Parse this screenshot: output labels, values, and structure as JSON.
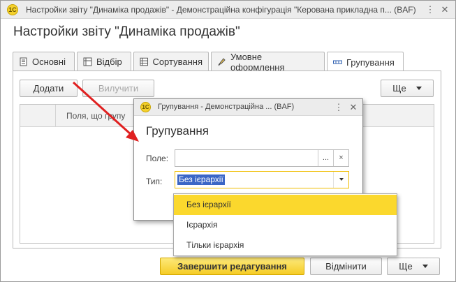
{
  "window": {
    "title": "Настройки звіту \"Динаміка продажів\" - Демонстраційна конфігурація \"Керована прикладна п... (BAF)",
    "logo": "1C"
  },
  "form_title": "Настройки звіту \"Динаміка продажів\"",
  "tabs": [
    {
      "label": "Основні",
      "icon": "document-icon"
    },
    {
      "label": "Відбір",
      "icon": "filter-icon"
    },
    {
      "label": "Сортування",
      "icon": "sort-icon"
    },
    {
      "label": "Умовне оформлення",
      "icon": "paint-icon"
    },
    {
      "label": "Групування",
      "icon": "grouping-icon"
    }
  ],
  "toolbar": {
    "add_label": "Додати",
    "exclude_label": "Вилучити",
    "more_label": "Ще"
  },
  "table": {
    "column_header": "Поля, що групу"
  },
  "dialog": {
    "title": "Групування - Демонстраційна ... (BAF)",
    "logo": "1C",
    "heading": "Групування",
    "field_label": "Поле:",
    "field_value": "",
    "type_label": "Тип:",
    "type_value": "Без ієрархії",
    "select_btn": "...",
    "clear_btn": "×"
  },
  "dropdown": {
    "options": [
      "Без ієрархії",
      "Ієрархія",
      "Тільки ієрархія"
    ],
    "selected": "Без ієрархії"
  },
  "footer": {
    "finish_label": "Завершити редагування",
    "cancel_label": "Відмінити",
    "more_label": "Ще"
  },
  "colors": {
    "accent": "#f5cc26",
    "selection": "#3b66c6",
    "annotation_arrow": "#e02020"
  }
}
